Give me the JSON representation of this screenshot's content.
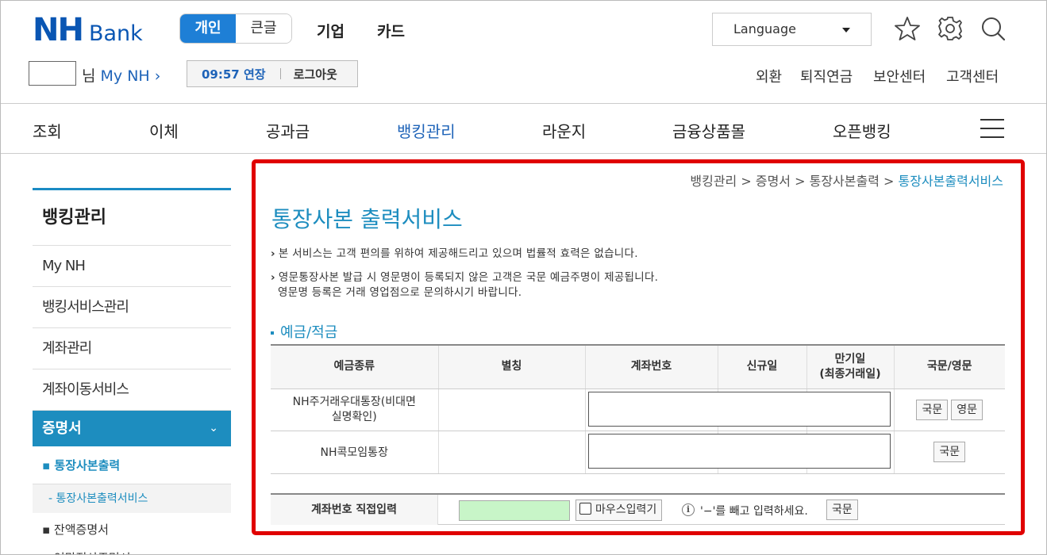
{
  "header": {
    "logo": {
      "nh": "NH",
      "bank": "Bank"
    },
    "segment": {
      "active": "개인",
      "inactive": "큰글"
    },
    "top_nav": [
      "기업",
      "카드"
    ],
    "language": {
      "label": "Language"
    },
    "user": {
      "suffix": "님",
      "mynh": "My NH ›"
    },
    "session": {
      "timer": "09:57 연장",
      "logout": "로그아웃"
    },
    "util_links": [
      "외환",
      "퇴직연금",
      "보안센터",
      "고객센터"
    ]
  },
  "menu": {
    "items": [
      "조회",
      "이체",
      "공과금",
      "뱅킹관리",
      "라운지",
      "금융상품몰",
      "오픈뱅킹"
    ],
    "active_index": 3
  },
  "sidebar": {
    "title": "뱅킹관리",
    "items": [
      "My NH",
      "뱅킹서비스관리",
      "계좌관리",
      "계좌이동서비스"
    ],
    "active": "증명서",
    "chevron": "⌄",
    "sub_active": "▪ 통장사본출력",
    "sub_sub_active": "- 통장사본출력서비스",
    "sub_more": [
      "▪ 잔액증명서",
      "▪ 연말정산증명서"
    ]
  },
  "breadcrumb": {
    "items": [
      "뱅킹관리",
      "증명서",
      "통장사본출력"
    ],
    "separator": " > ",
    "current": "통장사본출력서비스"
  },
  "main": {
    "title": "통장사본 출력서비스",
    "notes": [
      {
        "line1": "본 서비스는 고객 편의를 위하여 제공해드리고 있으며 법률적 효력은 없습니다.",
        "line2": ""
      },
      {
        "line1": "영문통장사본 발급 시 영문명이 등록되지 않은 고객은 국문 예금주명이 제공됩니다.",
        "line2": "영문명 등록은 거래 영업점으로 문의하시기 바랍니다."
      }
    ],
    "section_title": "예금/적금",
    "table": {
      "headers": [
        "예금종류",
        "별칭",
        "계좌번호",
        "신규일",
        "만기일",
        "(최종거래일)",
        "국문/영문"
      ],
      "rows": [
        {
          "type_line1": "NH주거래우대통장(비대면",
          "type_line2": "실명확인)",
          "buttons": [
            "국문",
            "영문"
          ]
        },
        {
          "type_line1": "NH콕모임통장",
          "type_line2": "",
          "buttons": [
            "국문"
          ]
        }
      ]
    },
    "direct_input": {
      "label": "계좌번호 직접입력",
      "mouse_label": "마우스입력기",
      "info_glyph": "i",
      "hint": "'−'를 빼고 입력하세요.",
      "button": "국문"
    }
  }
}
